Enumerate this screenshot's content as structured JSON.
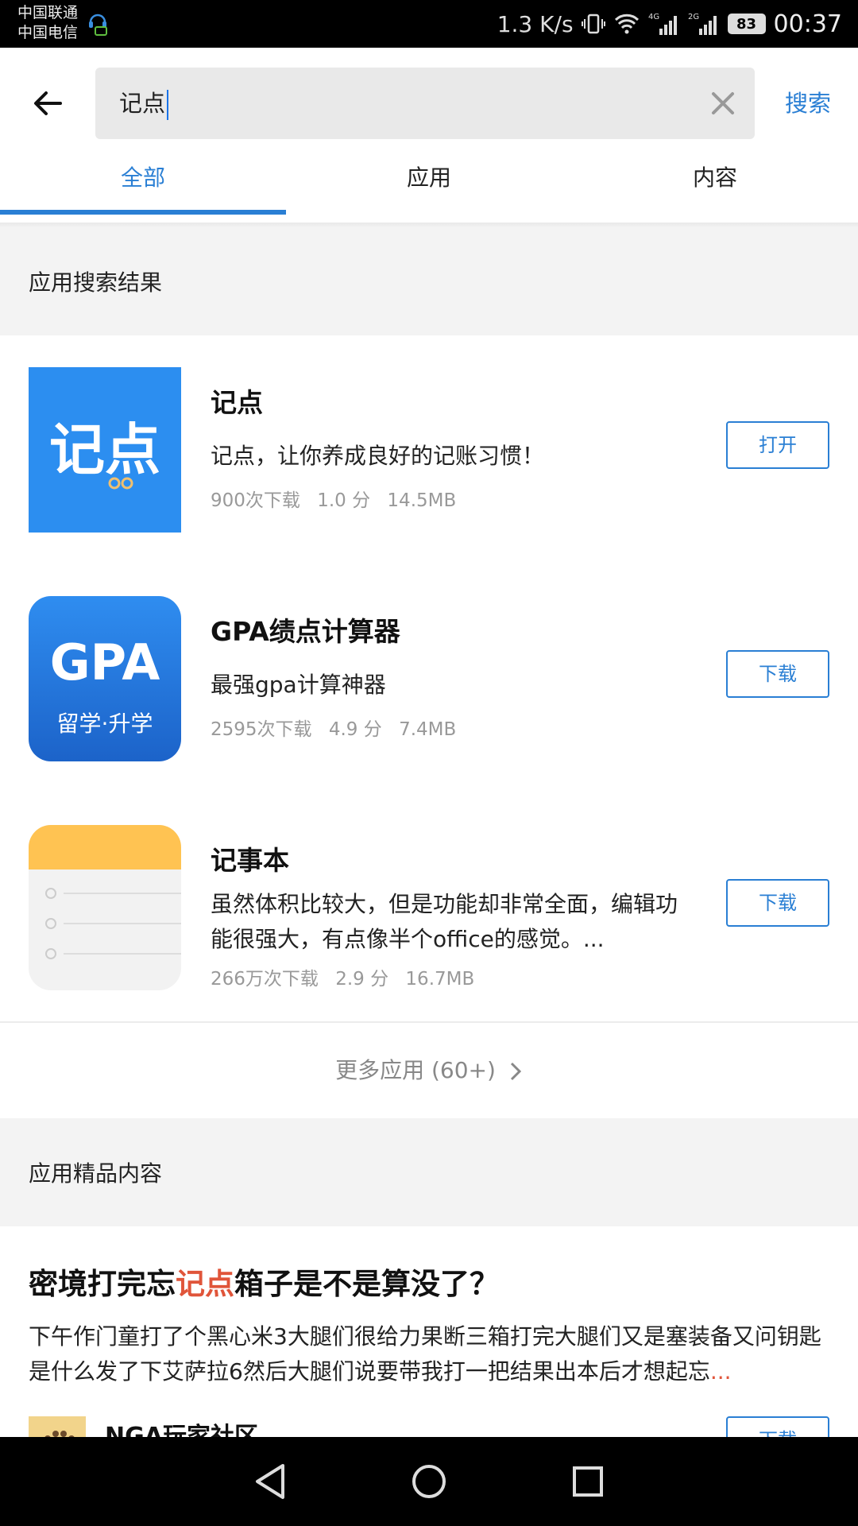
{
  "status_bar": {
    "carrier_1": "中国联通",
    "carrier_2": "中国电信",
    "net_speed": "1.3 K/s",
    "battery": "83",
    "time": "00:37",
    "icons": [
      "vibrate-icon",
      "wifi-icon",
      "signal-4g-icon",
      "signal-2g-icon",
      "battery-icon"
    ]
  },
  "search": {
    "value": "记点",
    "submit_label": "搜索"
  },
  "tabs": [
    {
      "label": "全部",
      "active": true
    },
    {
      "label": "应用",
      "active": false
    },
    {
      "label": "内容",
      "active": false
    }
  ],
  "apps_section": {
    "title": "应用搜索结果",
    "items": [
      {
        "name": "记点",
        "description": "记点，让你养成良好的记账习惯！",
        "downloads": "900次下载",
        "rating": "1.0 分",
        "size": "14.5MB",
        "action": "打开",
        "icon_text": "记点"
      },
      {
        "name": "GPA绩点计算器",
        "description": "最强gpa计算神器",
        "downloads": "2595次下载",
        "rating": "4.9 分",
        "size": "7.4MB",
        "action": "下载",
        "icon_text": "GPA",
        "icon_subtext": "留学·升学"
      },
      {
        "name": "记事本",
        "description": "虽然体积比较大，但是功能却非常全面，编辑功能很强大，有点像半个office的感觉。...",
        "downloads": "266万次下载",
        "rating": "2.9 分",
        "size": "16.7MB",
        "action": "下载"
      }
    ],
    "more_label": "更多应用 (60+)"
  },
  "content_section": {
    "title": "应用精品内容",
    "article": {
      "title_before": "密境打完忘",
      "title_highlight": "记点",
      "title_after": "箱子是不是算没了？",
      "body": "下午作门童打了个黑心米3大腿们很给力果断三箱打完大腿们又是塞装备又问钥匙是什么发了下艾萨拉6然后大腿们说要带我打一把结果出本后才想起忘",
      "body_ellipsis": "...",
      "source_name": "NGA玩家社区",
      "source_action": "下载"
    }
  },
  "colors": {
    "accent": "#2a7fd4",
    "highlight": "#e0553a",
    "section_bg": "#f3f3f3"
  }
}
